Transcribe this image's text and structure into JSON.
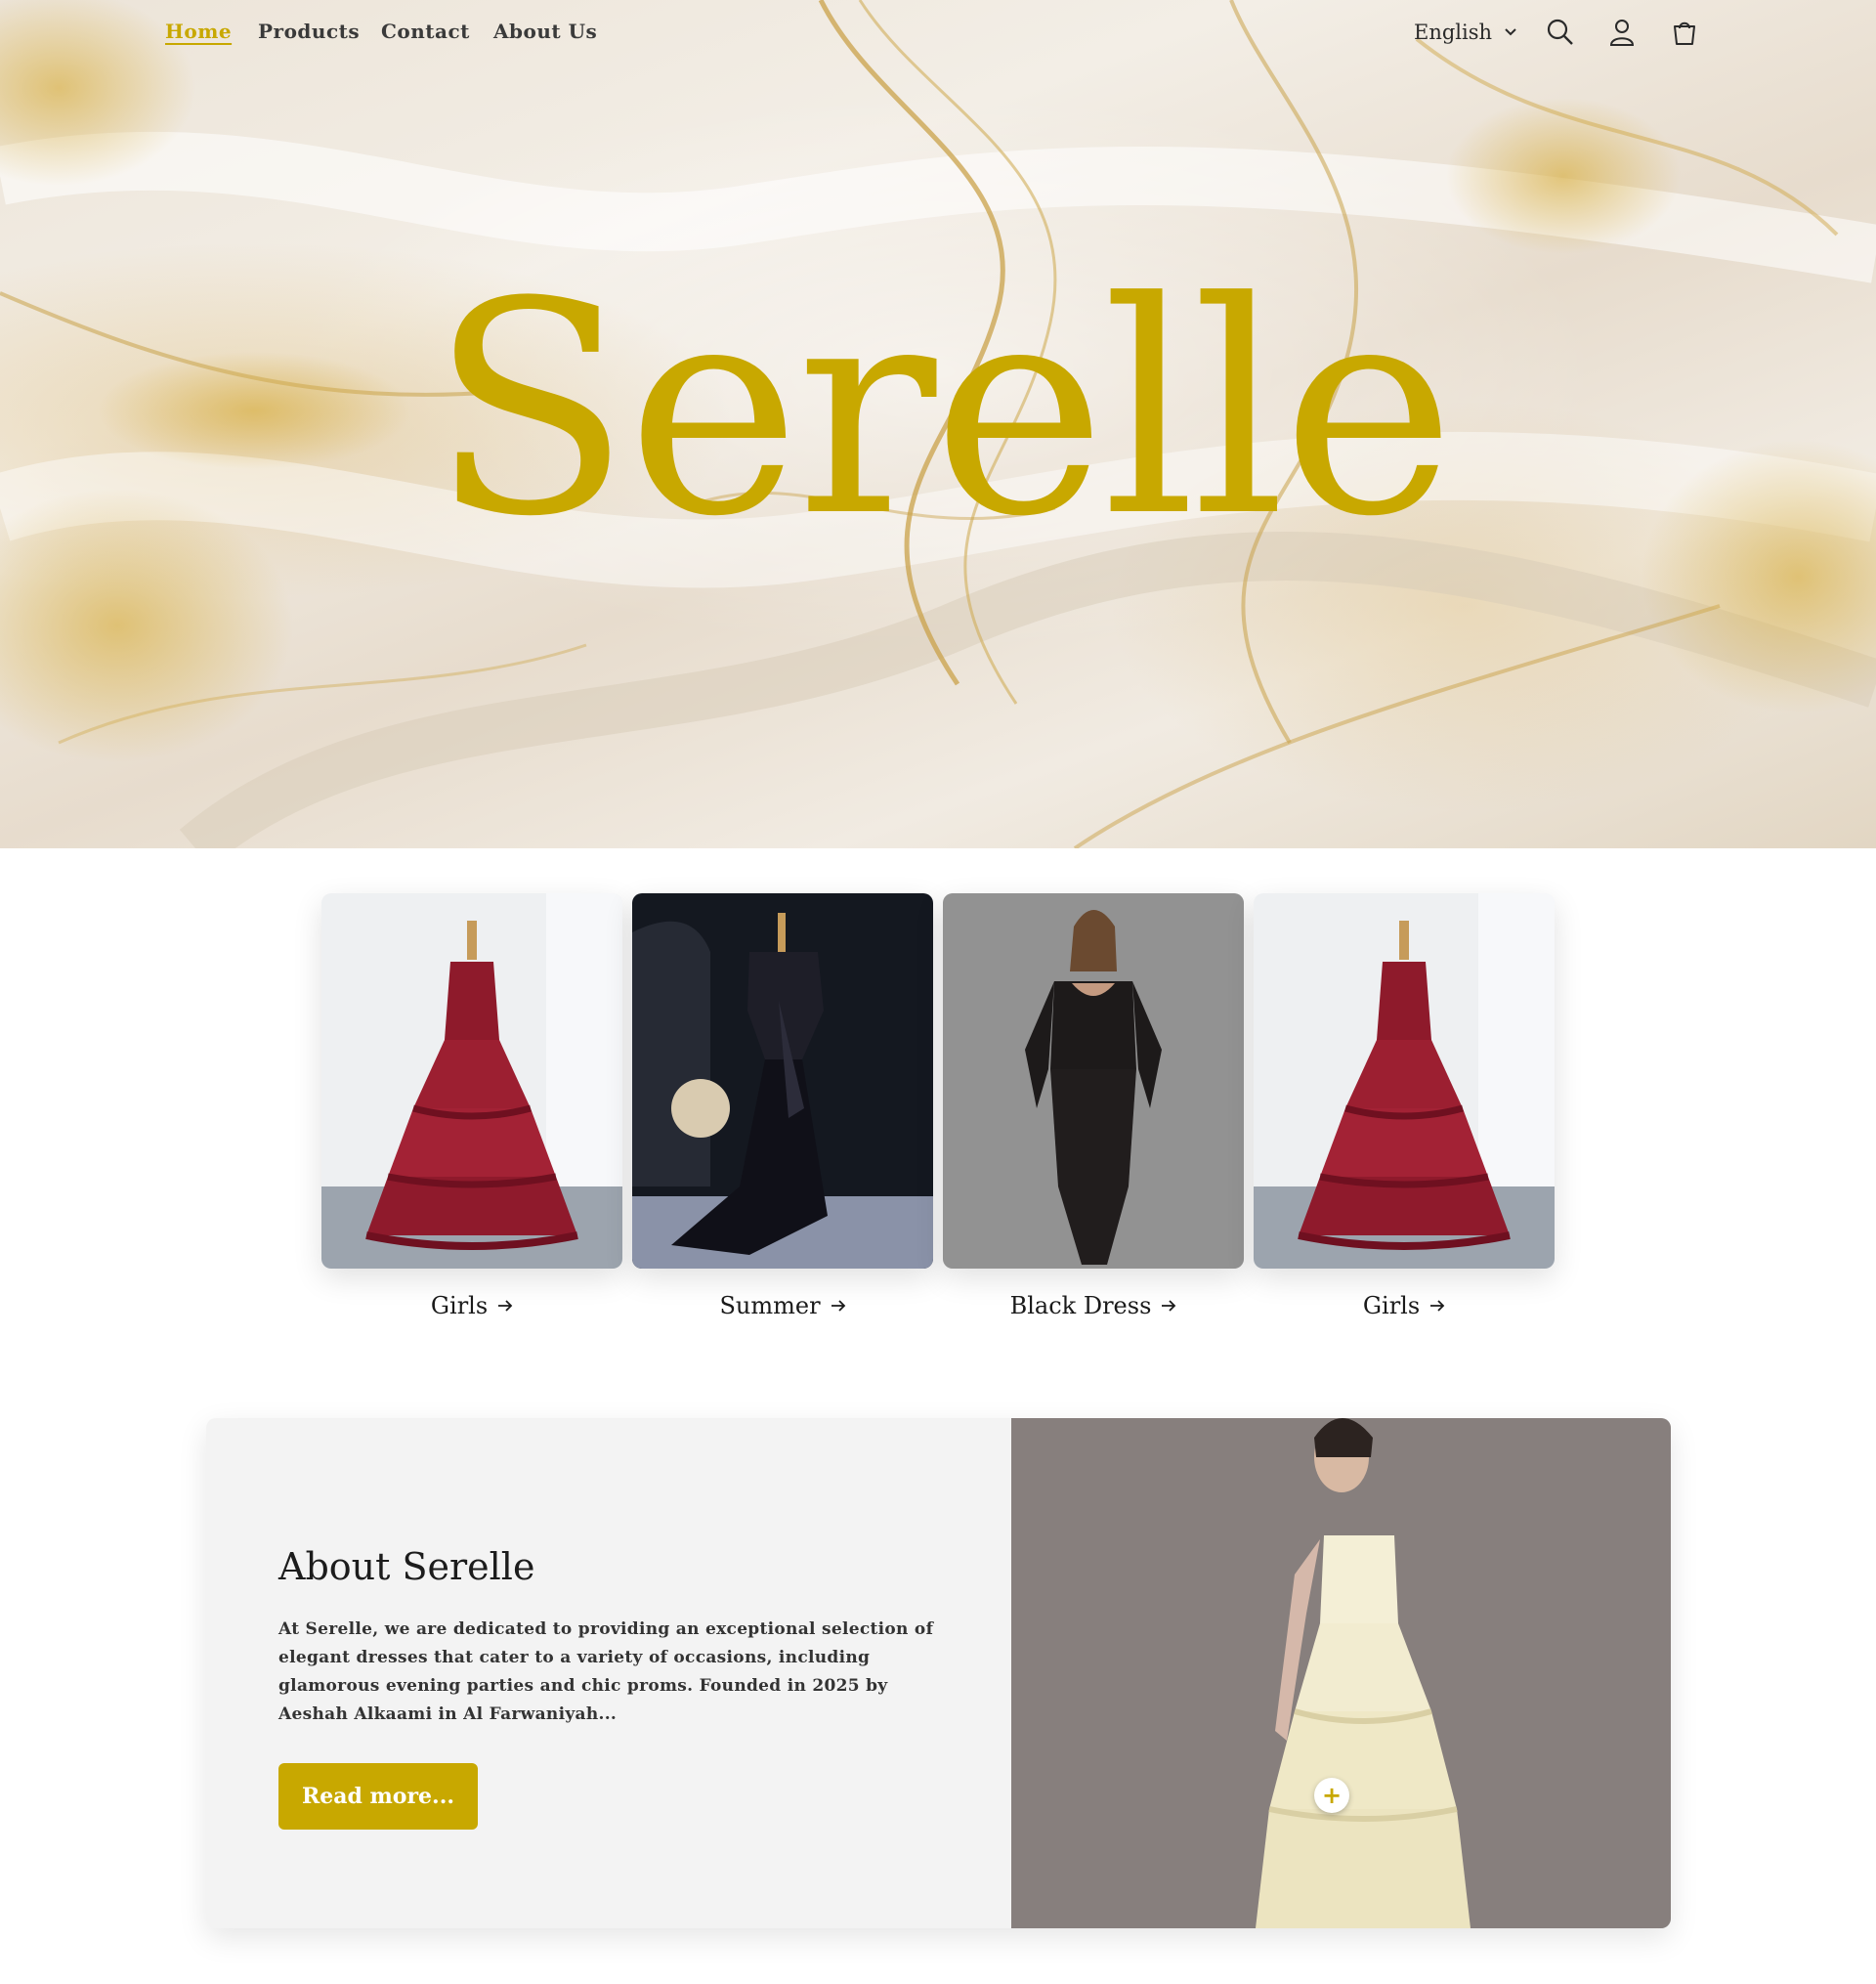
{
  "nav": {
    "links": [
      {
        "label": "Home",
        "active": true
      },
      {
        "label": "Products",
        "active": false
      },
      {
        "label": "Contact",
        "active": false
      },
      {
        "label": "About Us",
        "active": false
      }
    ],
    "language": "English",
    "icons": [
      "search-icon",
      "account-icon",
      "cart-icon"
    ]
  },
  "hero": {
    "logo": "Serelle"
  },
  "collections": [
    {
      "label": "Girls",
      "image": "burgundy-tiered-gown"
    },
    {
      "label": "Summer",
      "image": "black-satin-gown-on-mannequin"
    },
    {
      "label": "Black Dress",
      "image": "black-lace-fitted-dress"
    },
    {
      "label": "Girls",
      "image": "burgundy-tiered-gown"
    }
  ],
  "about": {
    "title": "About Serelle",
    "body": "At Serelle, we are dedicated to providing an exceptional selection of elegant dresses that cater to a variety of occasions, including glamorous evening parties and chic proms. Founded in 2025 by Aeshah Alkaami in Al Farwaniyah...",
    "button": "Read more...",
    "hotspot": "+"
  },
  "colors": {
    "accent": "#c8a800",
    "text": "#222222",
    "card_bg": "#f3f3f3"
  }
}
